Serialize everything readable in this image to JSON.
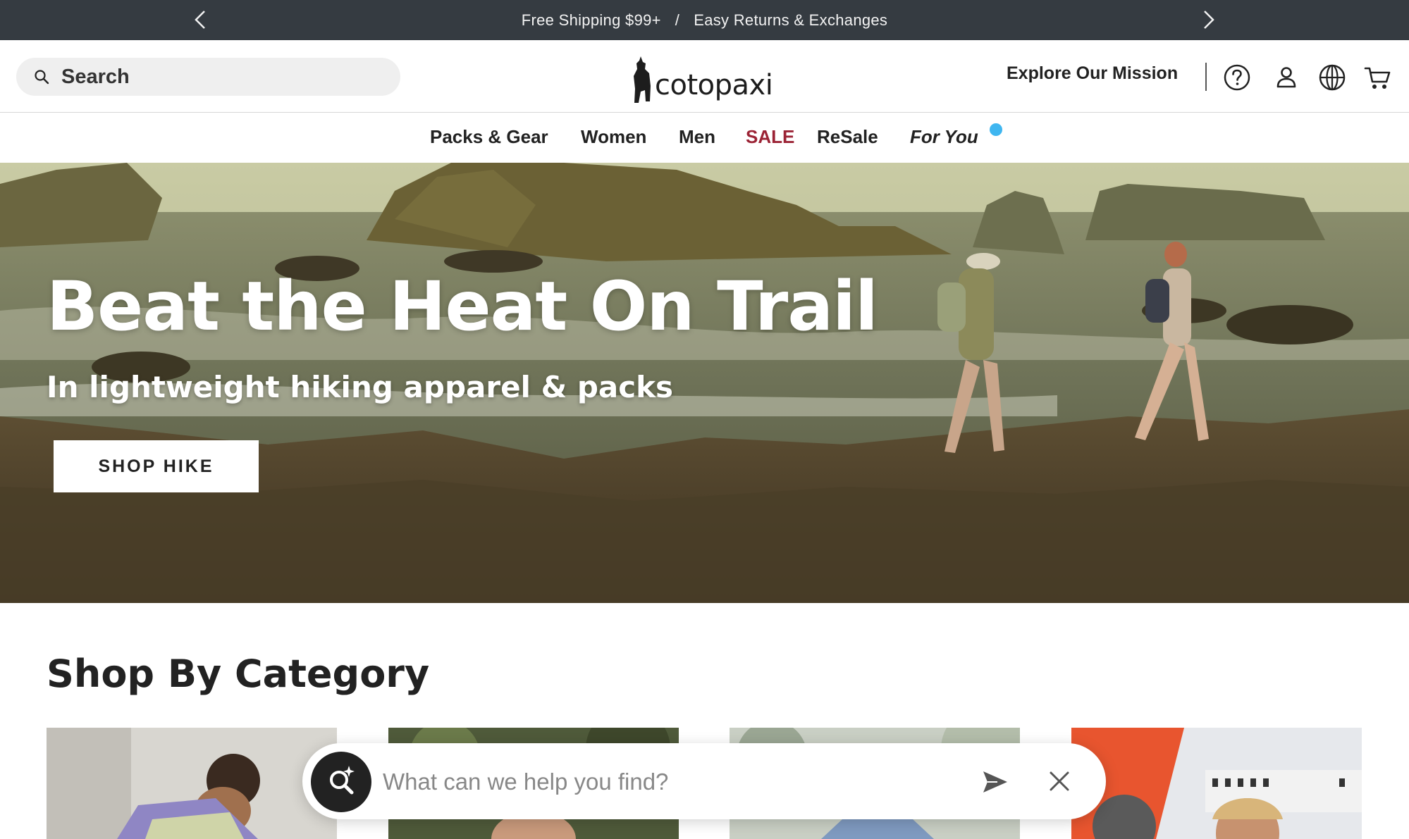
{
  "announcement": {
    "free_shipping": "Free Shipping $99+",
    "separator": "/",
    "returns": "Easy Returns & Exchanges",
    "prev_icon": "chevron-left-icon",
    "next_icon": "chevron-right-icon"
  },
  "header": {
    "search_placeholder": "Search",
    "logo_text": "cotopaxi",
    "mission_link": "Explore Our Mission",
    "icons": [
      "help-icon",
      "account-icon",
      "globe-icon",
      "cart-icon"
    ]
  },
  "nav": {
    "items": [
      {
        "label": "Packs & Gear"
      },
      {
        "label": "Women"
      },
      {
        "label": "Men"
      },
      {
        "label": "SALE"
      },
      {
        "label": "ReSale"
      },
      {
        "label": "For You"
      }
    ],
    "sale_color": "#9b2335",
    "notification_dot_color": "#3fb6f0"
  },
  "hero": {
    "title": "Beat the Heat On Trail",
    "subtitle": "In lightweight hiking apparel & packs",
    "cta_label": "SHOP HIKE"
  },
  "category": {
    "title": "Shop By Category"
  },
  "assistant": {
    "placeholder": "What can we help you find?",
    "icons": [
      "ai-search-icon",
      "send-icon",
      "close-icon"
    ]
  },
  "colors": {
    "announcement_bg": "#353b41",
    "text": "#222222",
    "search_bg": "#efefef"
  }
}
